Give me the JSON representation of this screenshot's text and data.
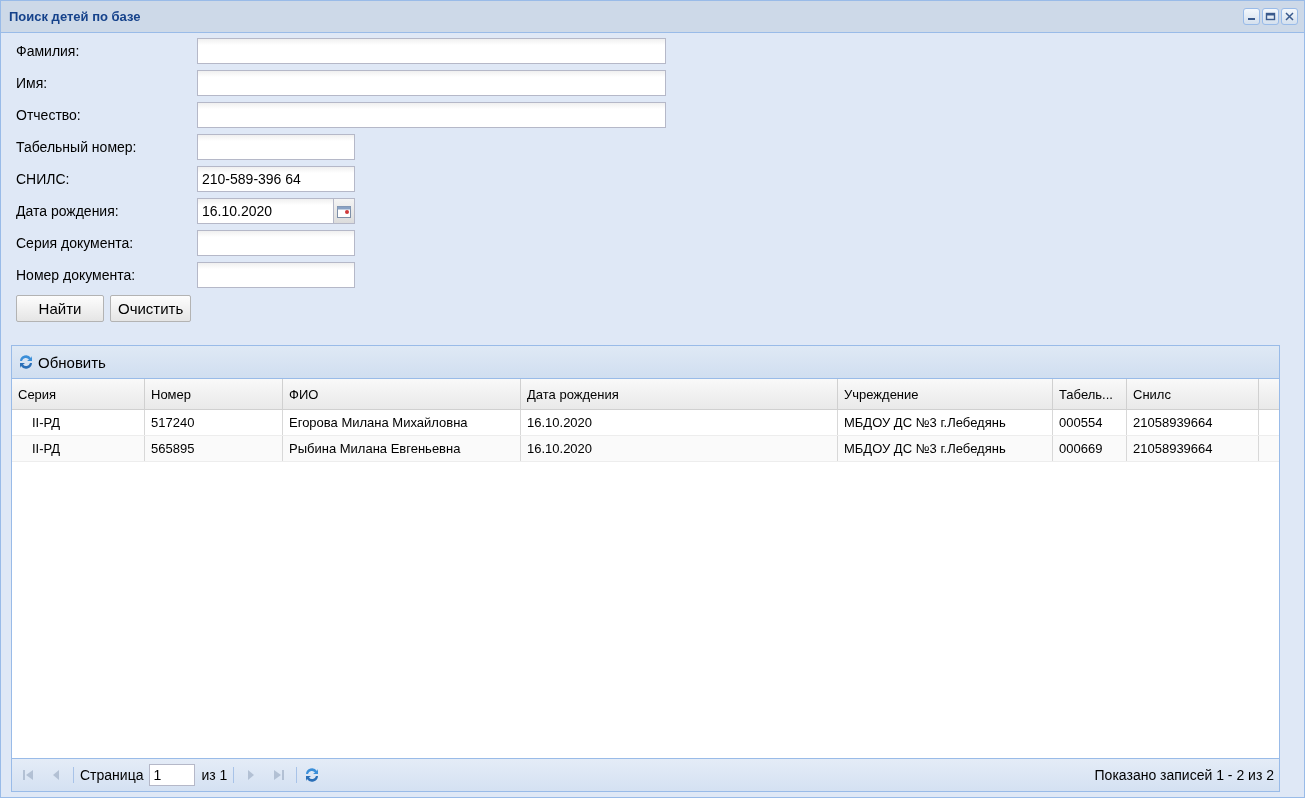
{
  "window": {
    "title": "Поиск детей по базе"
  },
  "form": {
    "fields": [
      {
        "label": "Фамилия:",
        "kind": "wide"
      },
      {
        "label": "Имя:",
        "kind": "wide"
      },
      {
        "label": "Отчество:",
        "kind": "wide"
      },
      {
        "label": "Табельный номер:",
        "kind": "narrow"
      },
      {
        "label": "СНИЛС:",
        "kind": "narrow",
        "value": "210-589-396 64"
      },
      {
        "label": "Дата рождения:",
        "kind": "date",
        "value": "16.10.2020"
      },
      {
        "label": "Серия документа:",
        "kind": "narrow"
      },
      {
        "label": "Номер документа:",
        "kind": "narrow"
      }
    ],
    "buttons": [
      "Найти",
      "Очистить"
    ]
  },
  "toolbar": {
    "refresh_label": "Обновить"
  },
  "table": {
    "columns": [
      "Серия",
      "Номер",
      "ФИО",
      "Дата рождения",
      "Учреждение",
      "Табель...",
      "Снилс"
    ],
    "rows": [
      [
        "II-РД",
        "517240",
        "Егорова Милана Михайловна",
        "16.10.2020",
        "МБДОУ ДС №3 г.Лебедянь",
        "000554",
        "21058939664"
      ],
      [
        "II-РД",
        "565895",
        "Рыбина Милана Евгеньевна",
        "16.10.2020",
        "МБДОУ ДС №3 г.Лебедянь",
        "000669",
        "21058939664"
      ]
    ]
  },
  "pager": {
    "first_disabled": true,
    "prev_disabled": true,
    "page_label": "Страница",
    "page": "1",
    "of_label": "из 1",
    "next_disabled": true,
    "last_disabled": true,
    "summary": "Показано записей 1 - 2 из 2"
  }
}
